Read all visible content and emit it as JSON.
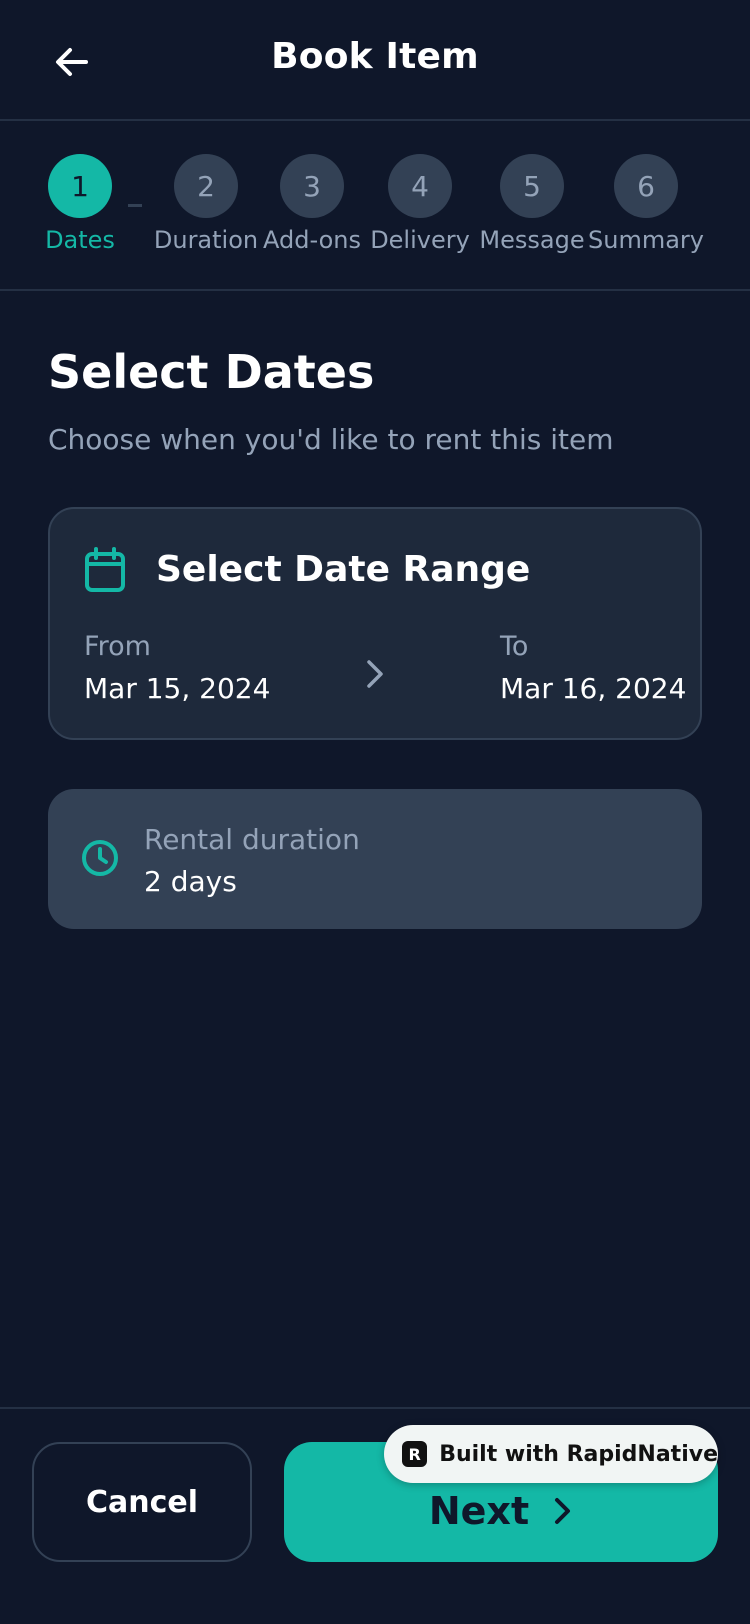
{
  "header": {
    "title": "Book Item",
    "back_icon": "arrow-left-icon"
  },
  "stepper": {
    "steps": [
      {
        "number": "1",
        "label": "Dates",
        "active": true
      },
      {
        "number": "2",
        "label": "Duration",
        "active": false
      },
      {
        "number": "3",
        "label": "Add-ons",
        "active": false
      },
      {
        "number": "4",
        "label": "Delivery",
        "active": false
      },
      {
        "number": "5",
        "label": "Message",
        "active": false
      },
      {
        "number": "6",
        "label": "Summary",
        "active": false
      }
    ]
  },
  "main": {
    "title": "Select Dates",
    "subtitle": "Choose when you'd like to rent this item",
    "date_range": {
      "title": "Select Date Range",
      "icon": "calendar-icon",
      "from_label": "From",
      "from_value": "Mar 15, 2024",
      "to_label": "To",
      "to_value": "Mar 16, 2024"
    },
    "duration": {
      "icon": "clock-icon",
      "label": "Rental duration",
      "value": "2 days"
    }
  },
  "footer": {
    "cancel_label": "Cancel",
    "next_label": "Next"
  },
  "badge": {
    "logo_letter": "R",
    "text": "Built with RapidNative"
  },
  "colors": {
    "background": "#0f172a",
    "card": "#1e293b",
    "muted_card": "#334155",
    "accent": "#14b8a6",
    "muted_text": "#94a3b8"
  }
}
